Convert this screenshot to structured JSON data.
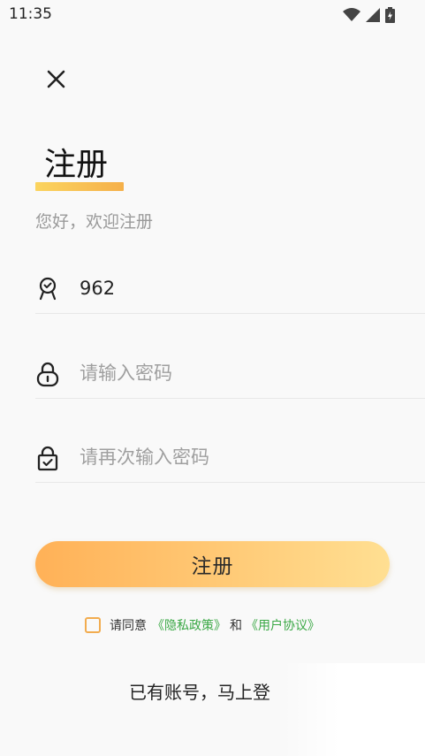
{
  "status_bar": {
    "time": "11:35",
    "icons": [
      "wifi-icon",
      "signal-icon",
      "battery-icon"
    ]
  },
  "header": {
    "close_icon": "close-icon"
  },
  "title": {
    "text": "注册",
    "underline_color": "#f5b04a"
  },
  "subtitle": "您好，欢迎注册",
  "form": {
    "account": {
      "icon": "badge-icon",
      "value": "962",
      "placeholder": ""
    },
    "password": {
      "icon": "lock-icon",
      "value": "",
      "placeholder": "请输入密码"
    },
    "confirm_password": {
      "icon": "lock-check-icon",
      "value": "",
      "placeholder": "请再次输入密码"
    }
  },
  "register_button": {
    "label": "注册",
    "gradient": [
      "#ffb157",
      "#ffdf92"
    ]
  },
  "agreement": {
    "checked": false,
    "prefix": "请同意",
    "privacy_link": "《隐私政策》",
    "and": "和",
    "terms_link": "《用户协议》",
    "link_color": "#3aa845"
  },
  "login_prompt": "已有账号，马上登"
}
